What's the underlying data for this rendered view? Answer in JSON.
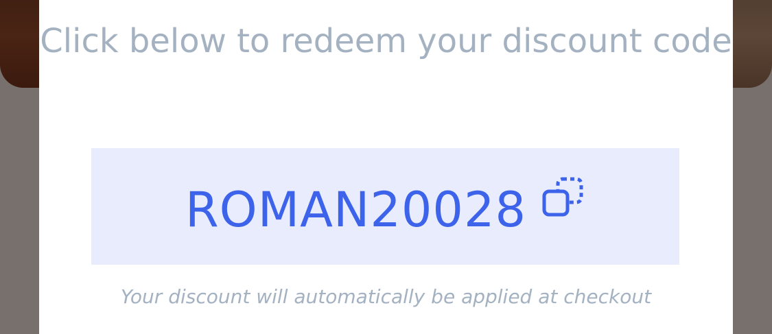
{
  "modal": {
    "headline": "Click below to redeem your discount code",
    "discount_code": "ROMAN20028",
    "copy_icon": "copy-icon",
    "footnote": "Your discount will automatically be applied at checkout"
  },
  "colors": {
    "code_text": "#3d63ea",
    "code_background": "#e8ecfd",
    "muted_text": "#a3b1c1",
    "overlay": "#77706c"
  }
}
